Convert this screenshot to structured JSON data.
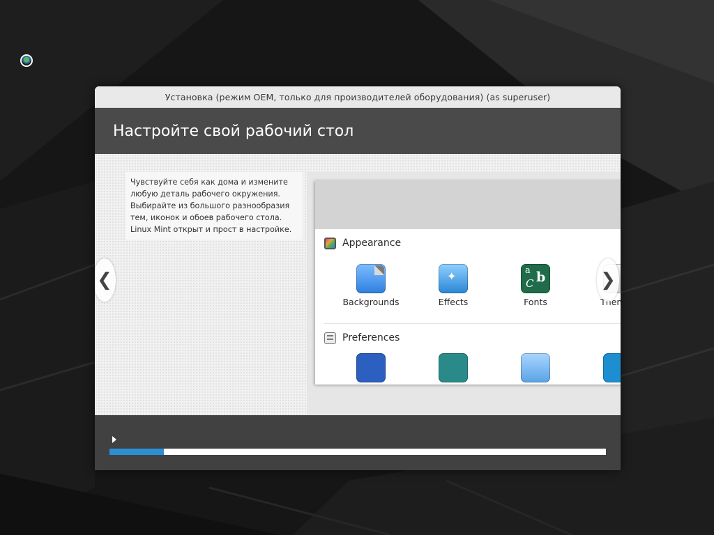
{
  "window": {
    "title": "Установка (режим OEM, только для производителей оборудования) (as superuser)"
  },
  "header": {
    "title": "Настройте свой рабочий стол"
  },
  "slide": {
    "description": "Чувствуйте себя как дома и измените любую деталь рабочего окружения. Выбирайте из большого разнообразия тем, иконок и обоев рабочего стола. Linux Mint открыт и прост в настройке.",
    "screenshot": {
      "appearance_section": "Appearance",
      "appearance_items": [
        "Backgrounds",
        "Effects",
        "Fonts",
        "Themes"
      ],
      "preferences_section": "Preferences"
    }
  },
  "nav": {
    "prev_glyph": "❮",
    "next_glyph": "❯"
  },
  "progress": {
    "fraction": 0.11
  },
  "icons": {
    "corner": "mint-logo-icon",
    "expander": "triangle-right-icon"
  },
  "colors": {
    "header_bg": "#4a4a4a",
    "footer_bg": "#414141",
    "progress_fill": "#2c8fd6"
  }
}
